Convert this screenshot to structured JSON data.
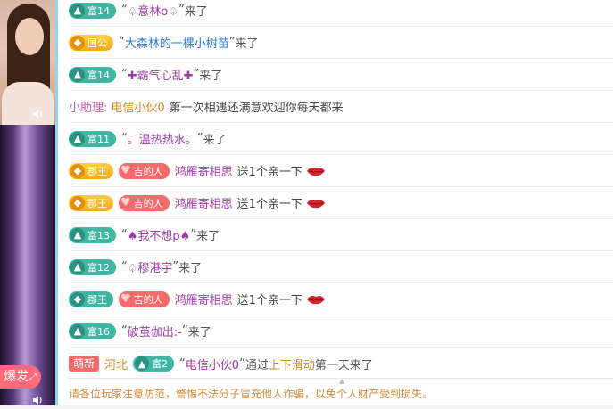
{
  "video": {
    "burst_label": "爆发",
    "burst_icon": "expand-icon"
  },
  "rows": [
    {
      "type": "enter",
      "badge": "富14",
      "name": "♤意林o♤",
      "suffix": "来了"
    },
    {
      "type": "enter-gold",
      "badge": "国公",
      "name": "大森林的一棵小树苗",
      "suffix": "来了"
    },
    {
      "type": "enter",
      "badge": "富14",
      "name": "✚霸气心乱✚",
      "suffix": "来了"
    },
    {
      "type": "assistant",
      "label": "小助理:",
      "name": "电信小伙0",
      "text": "第一次相遇还满意欢迎你每天都来"
    },
    {
      "type": "enter",
      "badge": "富11",
      "name": "。温热热水。",
      "suffix": "来了"
    },
    {
      "type": "gift",
      "badge": "郡王",
      "love": "吉的人",
      "name": "鸿雁寄相思",
      "text": "送1个亲一下"
    },
    {
      "type": "gift",
      "badge": "郡王",
      "love": "吉的人",
      "name": "鸿雁寄相思",
      "text": "送1个亲一下"
    },
    {
      "type": "enter",
      "badge": "富13",
      "name": "♠我不想p♠",
      "suffix": "来了"
    },
    {
      "type": "enter",
      "badge": "富12",
      "name": "♤穆港宇",
      "suffix": "来了"
    },
    {
      "type": "gift",
      "badge": "郡王",
      "love": "吉的人",
      "name": "鸿雁寄相思",
      "text": "送1个亲一下"
    },
    {
      "type": "enter",
      "badge": "富16",
      "name": "破茧伽出:-",
      "suffix": "来了"
    },
    {
      "type": "new",
      "tag": "萌新",
      "region": "河北",
      "badge": "富2",
      "name": "电信小伙0",
      "via": "通过",
      "method": "上下滑动",
      "rest": "第一天来了"
    }
  ],
  "footer": "请各位玩家注意防范，警惕不法分子冒充他人诈骗，以免个人财产受到损失。",
  "colors": {
    "accent": "#8fd4f2",
    "rich": "#3fb6a4",
    "gold": "#f0a91a",
    "love": "#f36b6b",
    "warning": "#d0893b"
  }
}
